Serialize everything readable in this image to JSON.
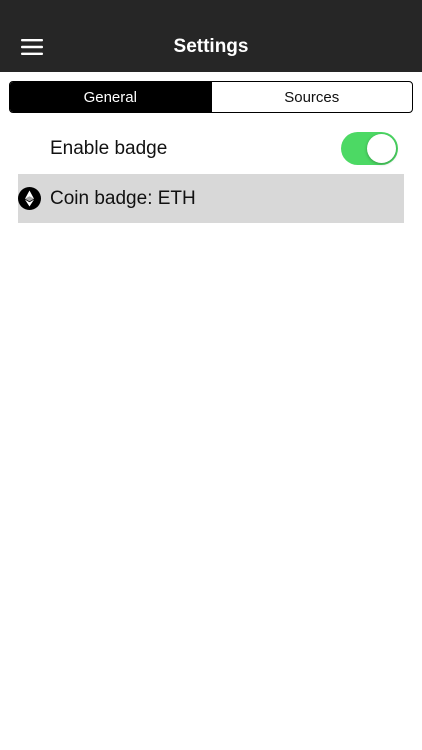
{
  "header": {
    "title": "Settings",
    "menu_icon": "hamburger-menu-icon",
    "background": "#262626"
  },
  "tabs": [
    {
      "label": "General",
      "active": true
    },
    {
      "label": "Sources",
      "active": false
    }
  ],
  "settings": {
    "enable_badge": {
      "label": "Enable badge",
      "enabled": true,
      "toggle_color": "#4cd964"
    },
    "coin_badge": {
      "label": "Coin badge: ETH",
      "icon": "ethereum-icon",
      "highlight_color": "#d8d8d8"
    }
  }
}
